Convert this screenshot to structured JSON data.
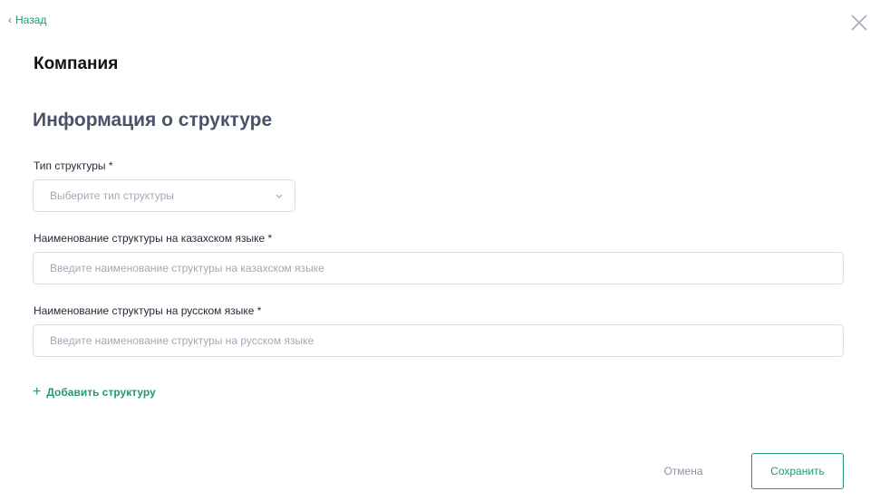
{
  "nav": {
    "back_label": "Назад",
    "back_icon": "chevron-left-icon",
    "close_icon": "close-icon"
  },
  "header": {
    "title": "Компания"
  },
  "form": {
    "section_title": "Информация о структуре",
    "structure_type": {
      "label": "Тип структуры *",
      "placeholder": "Выберите тип структуры",
      "icon": "chevron-down-icon"
    },
    "name_kz": {
      "label": "Наименование структуры на казахском языке *",
      "placeholder": "Введите наименование структуры на казахском языке",
      "value": ""
    },
    "name_ru": {
      "label": "Наименование структуры на русском языке *",
      "placeholder": "Введите наименование структуры на русском языке",
      "value": ""
    },
    "add_structure_label": "Добавить структуру",
    "add_icon": "plus-icon"
  },
  "actions": {
    "cancel_label": "Отмена",
    "save_label": "Сохранить"
  },
  "colors": {
    "accent": "#1f9d6a",
    "section_title": "#4b5368",
    "border": "#d9dee5",
    "placeholder": "#a3aab5",
    "muted": "#8a93a0"
  }
}
